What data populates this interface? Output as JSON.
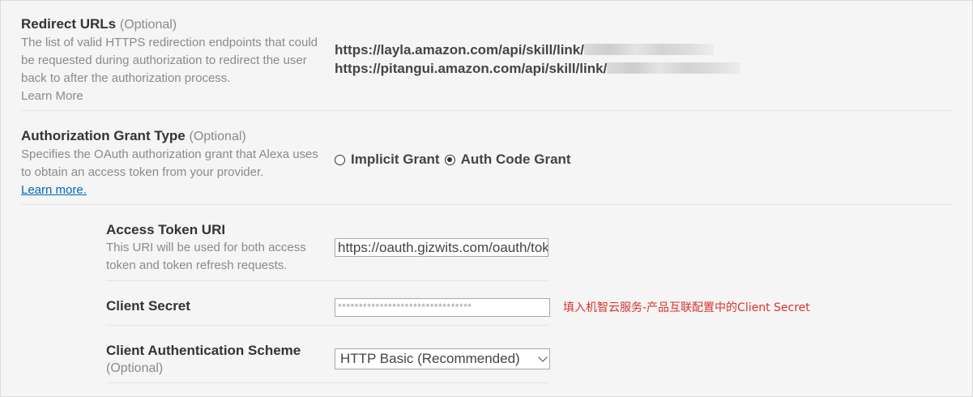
{
  "redirect": {
    "title": "Redirect URLs",
    "optional": "(Optional)",
    "description": "The list of valid HTTPS redirection endpoints that could be requested during authorization to redirect the user back to after the authorization process.",
    "learn_more": "Learn More",
    "urls": [
      "https://layla.amazon.com/api/skill/link/",
      "https://pitangui.amazon.com/api/skill/link/"
    ]
  },
  "grant": {
    "title": "Authorization Grant Type",
    "optional": "(Optional)",
    "description": "Specifies the OAuth authorization grant that Alexa uses to obtain an access token from your provider.",
    "learn_more": "Learn more.",
    "options": [
      {
        "label": "Implicit Grant",
        "checked": false
      },
      {
        "label": "Auth Code Grant",
        "checked": true
      }
    ]
  },
  "access_token": {
    "title": "Access Token URI",
    "description": "This URI will be used for both access token and token refresh requests.",
    "value": "https://oauth.gizwits.com/oauth/token"
  },
  "client_secret": {
    "title": "Client Secret",
    "value": "********************************",
    "note": "填入机智云服务-产品互联配置中的Client Secret"
  },
  "auth_scheme": {
    "title": "Client Authentication Scheme",
    "optional": "(Optional)",
    "selected": "HTTP Basic (Recommended)"
  }
}
